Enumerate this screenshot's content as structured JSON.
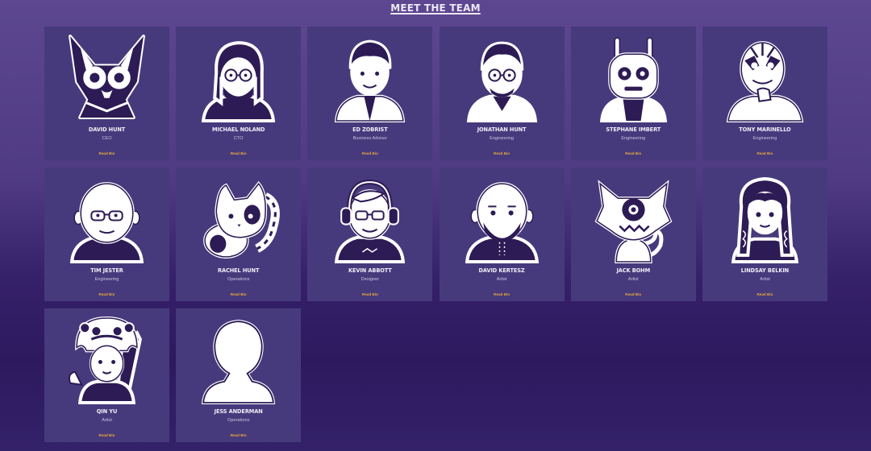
{
  "page": {
    "title": "MEET THE TEAM"
  },
  "members": [
    {
      "name": "DAVID HUNT",
      "role": "CEO",
      "link": "Read Bio",
      "avatar": "fox-goggles-avatar-icon"
    },
    {
      "name": "MICHAEL NOLAND",
      "role": "CTO",
      "link": "Read Bio",
      "avatar": "man-glasses-beard-avatar-icon"
    },
    {
      "name": "ED ZOBRIST",
      "role": "Business Advisor",
      "link": "Read Bio",
      "avatar": "man-labcoat-avatar-icon"
    },
    {
      "name": "JONATHAN HUNT",
      "role": "Engineering",
      "link": "Read Bio",
      "avatar": "man-glasses-avatar-icon"
    },
    {
      "name": "STEPHANE IMBERT",
      "role": "Engineering",
      "link": "Read Bio",
      "avatar": "robot-avatar-icon"
    },
    {
      "name": "TONY MARINELLO",
      "role": "Engineering",
      "link": "Read Bio",
      "avatar": "masked-wrestler-avatar-icon"
    },
    {
      "name": "TIM JESTER",
      "role": "Engineering",
      "link": "Read Bio",
      "avatar": "bald-man-glasses-avatar-icon"
    },
    {
      "name": "RACHEL HUNT",
      "role": "Operations",
      "link": "Read Bio",
      "avatar": "cat-avatar-icon"
    },
    {
      "name": "KEVIN ABBOTT",
      "role": "Designer",
      "link": "Read Bio",
      "avatar": "headphones-avatar-icon"
    },
    {
      "name": "DAVID KERTESZ",
      "role": "Artist",
      "link": "Read Bio",
      "avatar": "bald-beard-avatar-icon"
    },
    {
      "name": "JACK BOHM",
      "role": "Artist",
      "link": "Read Bio",
      "avatar": "cyclops-monster-avatar-icon"
    },
    {
      "name": "LINDSAY BELKIN",
      "role": "Artist",
      "link": "Read Bio",
      "avatar": "braids-girl-avatar-icon"
    },
    {
      "name": "QIN YU",
      "role": "Artist",
      "link": "Read Bio",
      "avatar": "lion-hat-avatar-icon"
    },
    {
      "name": "JESS ANDERMAN",
      "role": "Operations",
      "link": "Read Bio",
      "avatar": "silhouette-avatar-icon"
    }
  ],
  "colors": {
    "card": "#473a7c",
    "ink": "#2d1b55",
    "link": "#e7a83a"
  }
}
